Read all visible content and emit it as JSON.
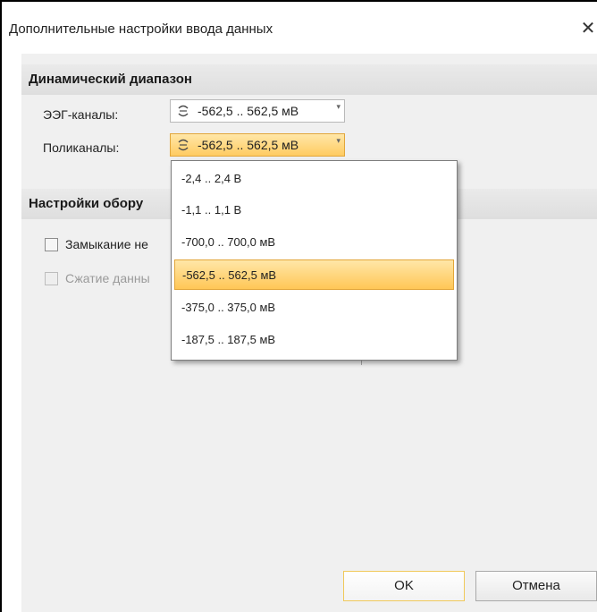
{
  "window": {
    "title": "Дополнительные настройки ввода данных",
    "close_glyph": "✕"
  },
  "dynamic_range": {
    "header": "Динамический диапазон",
    "eeg_label": "ЭЭГ-каналы:",
    "eeg_value": "-562,5 .. 562,5 мВ",
    "poly_label": "Поликаналы:",
    "poly_value": "-562,5 .. 562,5 мВ"
  },
  "hardware": {
    "header_visible": "Настройки обору",
    "checkbox1_label_visible": "Замыкание не",
    "checkbox2_label_visible": "Сжатие данны"
  },
  "dropdown": {
    "options": [
      "-2,4 .. 2,4 В",
      "-1,1 .. 1,1 В",
      "-700,0 .. 700,0 мВ",
      "-562,5 .. 562,5 мВ",
      "-375,0 .. 375,0 мВ",
      "-187,5 .. 187,5 мВ"
    ],
    "selected_index": 3
  },
  "buttons": {
    "ok": "OK",
    "cancel": "Отмена"
  },
  "colors": {
    "accent_orange": "#ffcb61",
    "accent_border": "#e2a63a"
  }
}
